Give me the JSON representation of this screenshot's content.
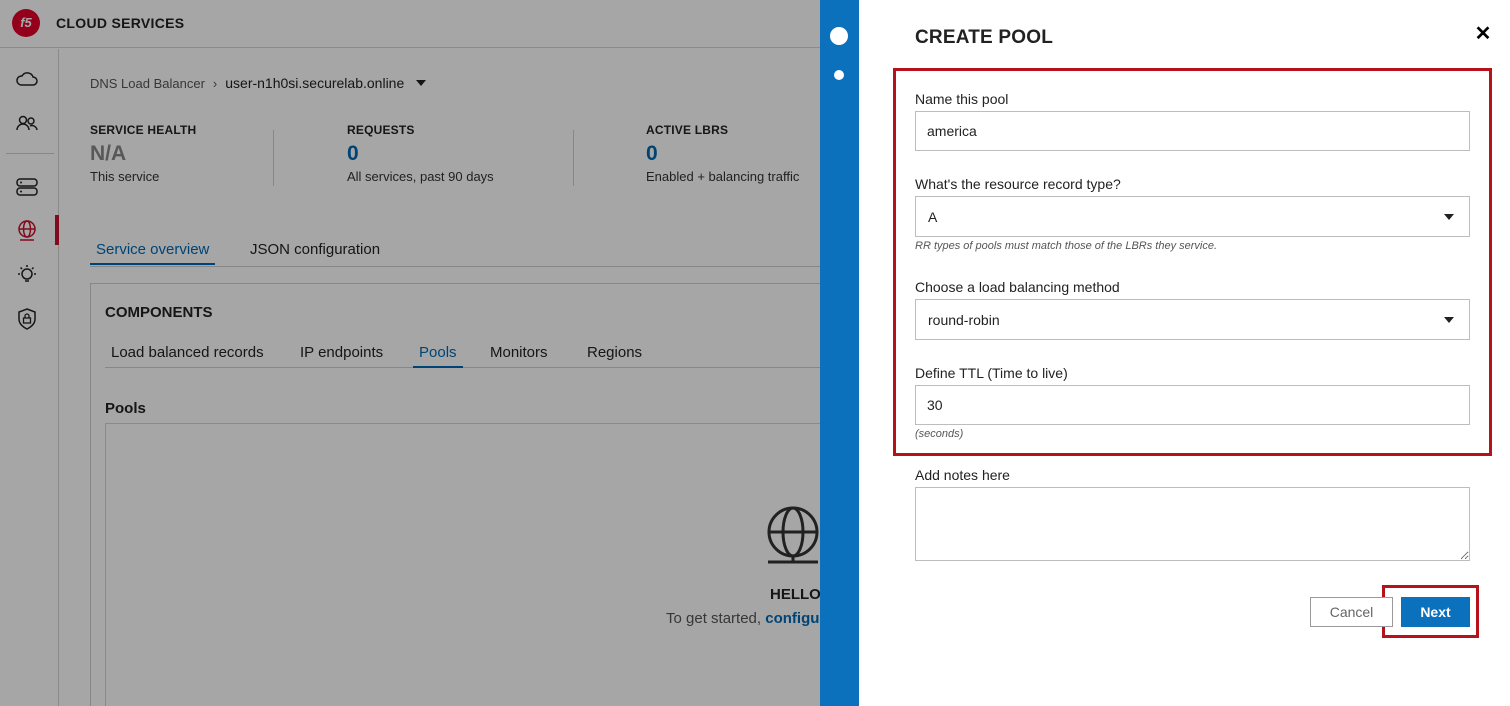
{
  "app": {
    "brand_logo_text": "f5",
    "brand": "CLOUD SERVICES"
  },
  "sidenav": {
    "items": [
      {
        "icon": "cloud-icon"
      },
      {
        "icon": "users-icon"
      },
      {
        "icon": "servers-icon"
      },
      {
        "icon": "globe-icon",
        "active": true
      },
      {
        "icon": "lightbulb-icon"
      },
      {
        "icon": "shield-lock-icon"
      }
    ]
  },
  "breadcrumb": {
    "parent": "DNS Load Balancer",
    "current": "user-n1h0si.securelab.online"
  },
  "stats": [
    {
      "label": "SERVICE HEALTH",
      "value": "N/A",
      "sub": "This service"
    },
    {
      "label": "REQUESTS",
      "value": "0",
      "sub": "All services, past 90 days"
    },
    {
      "label": "ACTIVE LBRS",
      "value": "0",
      "sub": "Enabled + balancing traffic"
    }
  ],
  "main_tabs": [
    {
      "label": "Service overview",
      "active": true
    },
    {
      "label": "JSON configuration",
      "active": false
    }
  ],
  "components": {
    "title": "COMPONENTS",
    "tabs": [
      {
        "label": "Load balanced records"
      },
      {
        "label": "IP endpoints"
      },
      {
        "label": "Pools",
        "active": true
      },
      {
        "label": "Monitors"
      },
      {
        "label": "Regions"
      }
    ],
    "section_label": "Pools",
    "empty_title": "HELLO",
    "empty_text": "To get started, ",
    "empty_link": "configu"
  },
  "drawer": {
    "title": "CREATE POOL",
    "close_icon": "close-icon",
    "name_label": "Name this pool",
    "name_value": "america",
    "rr_label": "What's the resource record type?",
    "rr_value": "A",
    "rr_hint": "RR types of pools must match those of the LBRs they service.",
    "lb_label": "Choose a load balancing method",
    "lb_value": "round-robin",
    "ttl_label": "Define TTL (Time to live)",
    "ttl_value": "30",
    "ttl_hint": "(seconds)",
    "notes_label": "Add notes here",
    "notes_value": "",
    "cancel_label": "Cancel",
    "next_label": "Next"
  },
  "colors": {
    "accent": "#0b71bd",
    "brand_red": "#e4002b",
    "highlight_red": "#b5121b"
  }
}
